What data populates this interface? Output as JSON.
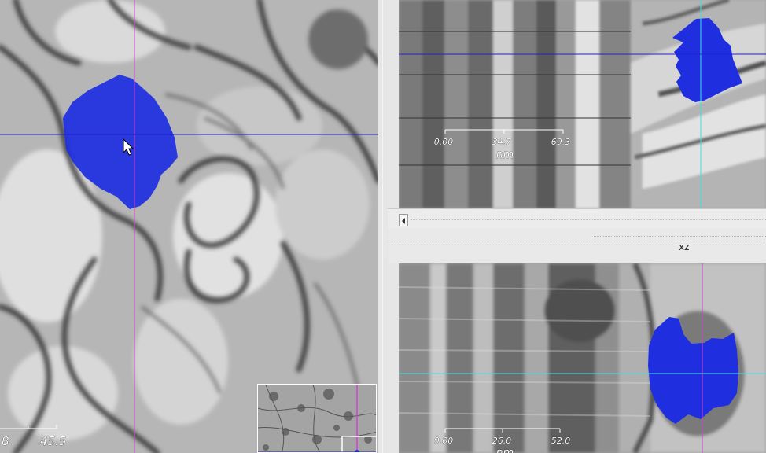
{
  "left_view": {
    "scalebar": {
      "label_a": "8",
      "label_b": "45.5"
    }
  },
  "top_right_view": {
    "scalebar": {
      "tick_0": "0.00",
      "tick_1": "34.7",
      "tick_2": "69.3",
      "unit": "nm"
    }
  },
  "bottom_right_view": {
    "title": "xz",
    "scalebar": {
      "tick_0": "0.00",
      "tick_1": "26.0",
      "tick_2": "52.0",
      "unit": "nm"
    }
  },
  "colors": {
    "segment_fill": "#1f2fe0",
    "crosshair_magenta": "#d040d0",
    "crosshair_blue": "#2020d0",
    "crosshair_cyan": "#40e0e0"
  },
  "icons": {
    "cursor": "mouse-pointer-icon",
    "scroll_left": "arrow-left-icon"
  }
}
